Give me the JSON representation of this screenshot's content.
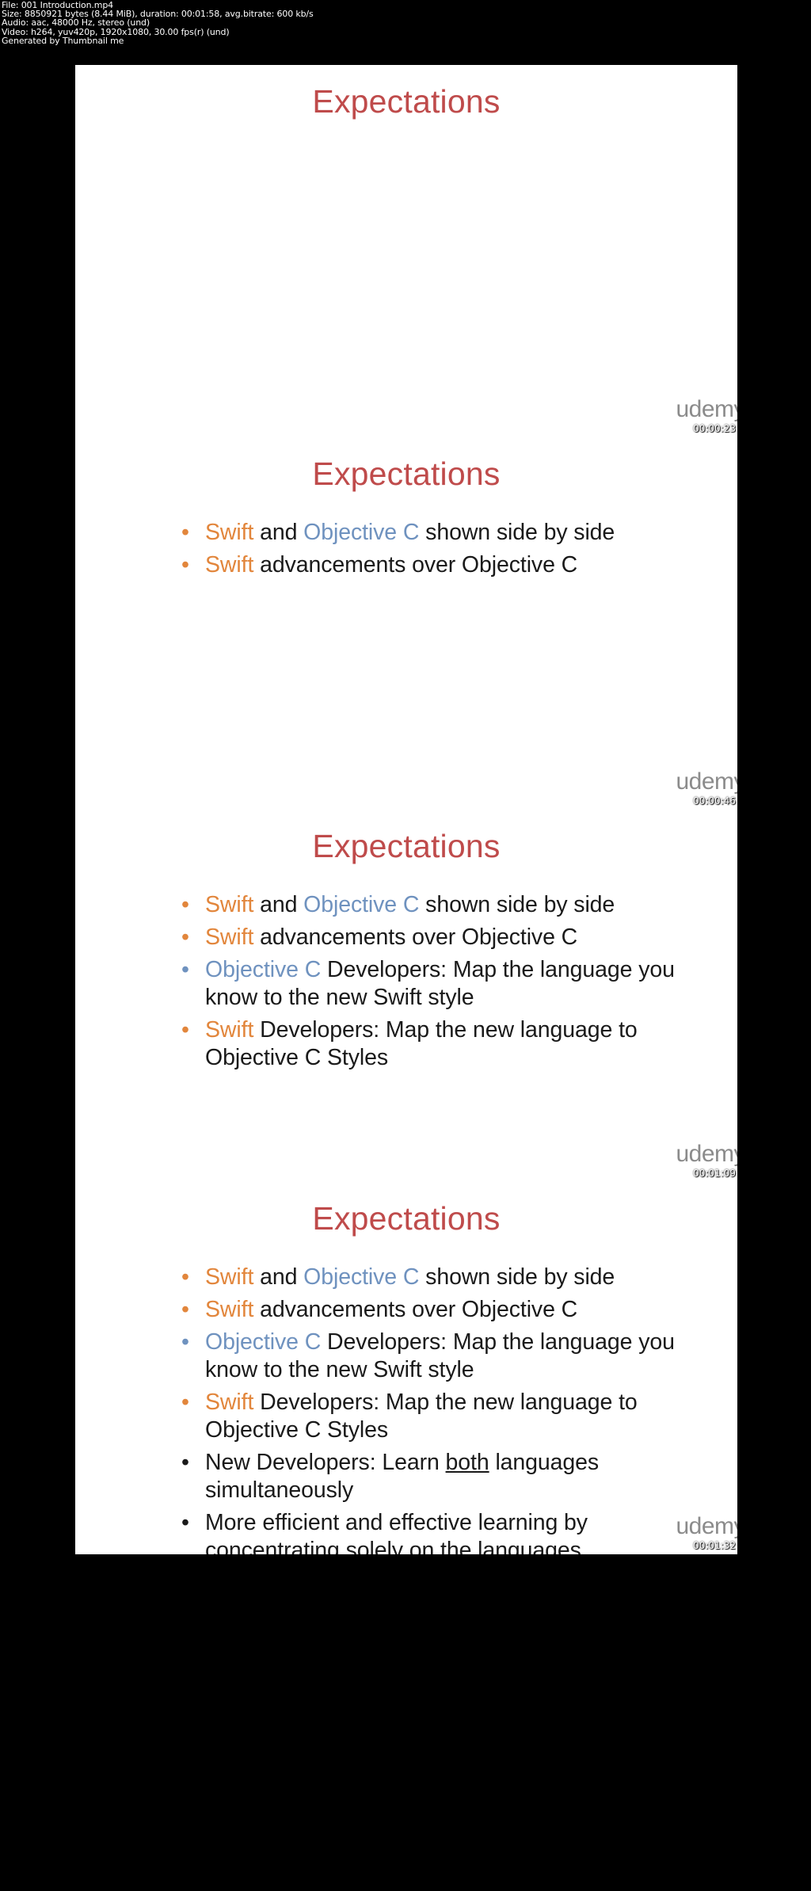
{
  "header": {
    "lines": [
      "File: 001 Introduction.mp4",
      "Size: 8850921 bytes (8.44 MiB), duration: 00:01:58, avg.bitrate: 600 kb/s",
      "Audio: aac, 48000 Hz, stereo (und)",
      "Video: h264, yuv420p, 1920x1080, 30.00 fps(r) (und)",
      "Generated by Thumbnail me"
    ]
  },
  "colors": {
    "title_red": "#bf4b4b",
    "swift_orange": "#e2863c",
    "objc_blue": "#6f92bf",
    "body_text": "#1a1a1a",
    "background": "#000000",
    "slide_bg": "#ffffff",
    "watermark_gray": "#8b8b8b"
  },
  "watermark": {
    "label": "udemy"
  },
  "slides": [
    {
      "title": "Expectations",
      "timestamp": "00:00:23",
      "bullets": []
    },
    {
      "title": "Expectations",
      "timestamp": "00:00:46",
      "bullets": [
        {
          "dot_color": "orange",
          "runs": [
            {
              "text": "Swift",
              "style": "swift"
            },
            {
              "text": " and ",
              "style": "plain"
            },
            {
              "text": "Objective C",
              "style": "objc"
            },
            {
              "text": " shown side by side",
              "style": "plain"
            }
          ]
        },
        {
          "dot_color": "orange",
          "runs": [
            {
              "text": "Swift",
              "style": "swift"
            },
            {
              "text": " advancements over Objective C",
              "style": "plain"
            }
          ]
        }
      ]
    },
    {
      "title": "Expectations",
      "timestamp": "00:01:09",
      "bullets": [
        {
          "dot_color": "orange",
          "runs": [
            {
              "text": "Swift",
              "style": "swift"
            },
            {
              "text": " and ",
              "style": "plain"
            },
            {
              "text": "Objective C",
              "style": "objc"
            },
            {
              "text": " shown side by side",
              "style": "plain"
            }
          ]
        },
        {
          "dot_color": "orange",
          "runs": [
            {
              "text": "Swift",
              "style": "swift"
            },
            {
              "text": " advancements over Objective C",
              "style": "plain"
            }
          ]
        },
        {
          "dot_color": "blue",
          "runs": [
            {
              "text": "Objective C",
              "style": "objc"
            },
            {
              "text": " Developers: Map the language you know to the new Swift style",
              "style": "plain"
            }
          ]
        },
        {
          "dot_color": "orange",
          "runs": [
            {
              "text": "Swift",
              "style": "swift"
            },
            {
              "text": " Developers: Map the new language to Objective C Styles",
              "style": "plain"
            }
          ]
        }
      ]
    },
    {
      "title": "Expectations",
      "timestamp": "00:01:32",
      "bullets": [
        {
          "dot_color": "orange",
          "runs": [
            {
              "text": "Swift",
              "style": "swift"
            },
            {
              "text": " and ",
              "style": "plain"
            },
            {
              "text": "Objective C",
              "style": "objc"
            },
            {
              "text": " shown side by side",
              "style": "plain"
            }
          ]
        },
        {
          "dot_color": "orange",
          "runs": [
            {
              "text": "Swift",
              "style": "swift"
            },
            {
              "text": " advancements over Objective C",
              "style": "plain"
            }
          ]
        },
        {
          "dot_color": "blue",
          "runs": [
            {
              "text": "Objective C",
              "style": "objc"
            },
            {
              "text": " Developers: Map the language you know to the new Swift style",
              "style": "plain"
            }
          ]
        },
        {
          "dot_color": "orange",
          "runs": [
            {
              "text": "Swift",
              "style": "swift"
            },
            {
              "text": " Developers: Map the new language to Objective C Styles",
              "style": "plain"
            }
          ]
        },
        {
          "dot_color": "dark",
          "runs": [
            {
              "text": "New Developers: Learn ",
              "style": "plain"
            },
            {
              "text": "both",
              "style": "underline"
            },
            {
              "text": " languages simultaneously",
              "style": "plain"
            }
          ]
        },
        {
          "dot_color": "dark",
          "runs": [
            {
              "text": "More efficient and effective learning by concentrating ",
              "style": "plain"
            },
            {
              "text": "solely",
              "style": "underline"
            },
            {
              "text": " on the languages",
              "style": "plain"
            }
          ]
        }
      ]
    }
  ]
}
